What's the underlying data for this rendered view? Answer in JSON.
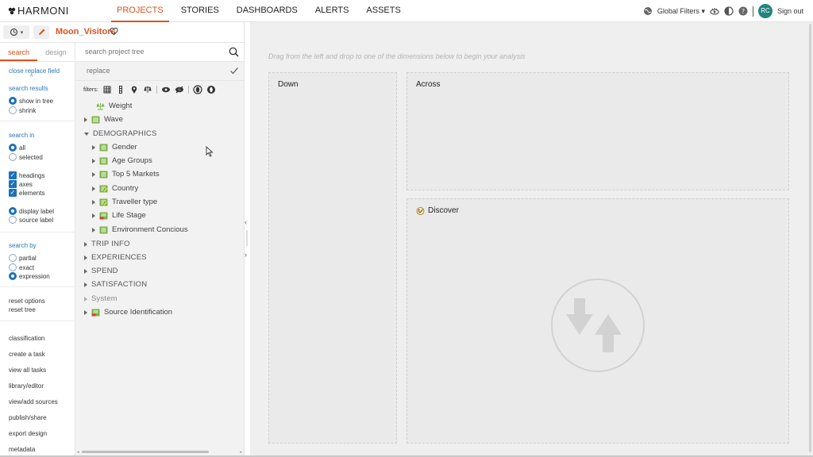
{
  "brand": "HARMONI",
  "nav": [
    "PROJECTS",
    "STORIES",
    "DASHBOARDS",
    "ALERTS",
    "ASSETS"
  ],
  "nav_active": "PROJECTS",
  "topright": {
    "global_filters": "Global Filters",
    "avatar_initials": "RC",
    "sign_out": "Sign out"
  },
  "project": {
    "name": "Moon_Visitors"
  },
  "left_tabs": {
    "search": "search",
    "design": "design"
  },
  "options": {
    "close_replace": "close replace field",
    "search_results": "search results",
    "show_in_tree": "show in tree",
    "shrink": "shrink",
    "search_in": "search in",
    "all": "all",
    "selected": "selected",
    "headings": "headings",
    "axes": "axes",
    "elements": "elements",
    "display_label": "display label",
    "source_label": "source label",
    "search_by": "search by",
    "partial": "partial",
    "exact": "exact",
    "expression": "expression",
    "reset_options": "reset options",
    "reset_tree": "reset tree"
  },
  "actions": [
    "classification",
    "create a task",
    "view all tasks",
    "library/editor",
    "view/add sources",
    "publish/share",
    "export design",
    "metadata"
  ],
  "tree": {
    "search_placeholder": "search project tree",
    "replace_placeholder": "replace",
    "filters_label": "filters:",
    "nodes": {
      "weight": "Weight",
      "wave": "Wave",
      "demographics": "DEMOGRAPHICS",
      "gender": "Gender",
      "age_groups": "Age Groups",
      "top5": "Top 5 Markets",
      "country": "Country",
      "traveller": "Traveller type",
      "life_stage": "Life Stage",
      "environment": "Environment Concious",
      "trip_info": "TRIP INFO",
      "experiences": "EXPERIENCES",
      "spend": "SPEND",
      "satisfaction": "SATISFACTION",
      "system": "System",
      "source_id": "Source Identification"
    }
  },
  "canvas": {
    "hint": "Drag from the left and drop to one of the dimensions below to begin your analysis",
    "down": "Down",
    "across": "Across",
    "discover": "Discover"
  },
  "colors": {
    "accent": "#d9541e",
    "blue": "#1e72b8",
    "avatar": "#23847f",
    "tree_icon": "#7cb342"
  }
}
